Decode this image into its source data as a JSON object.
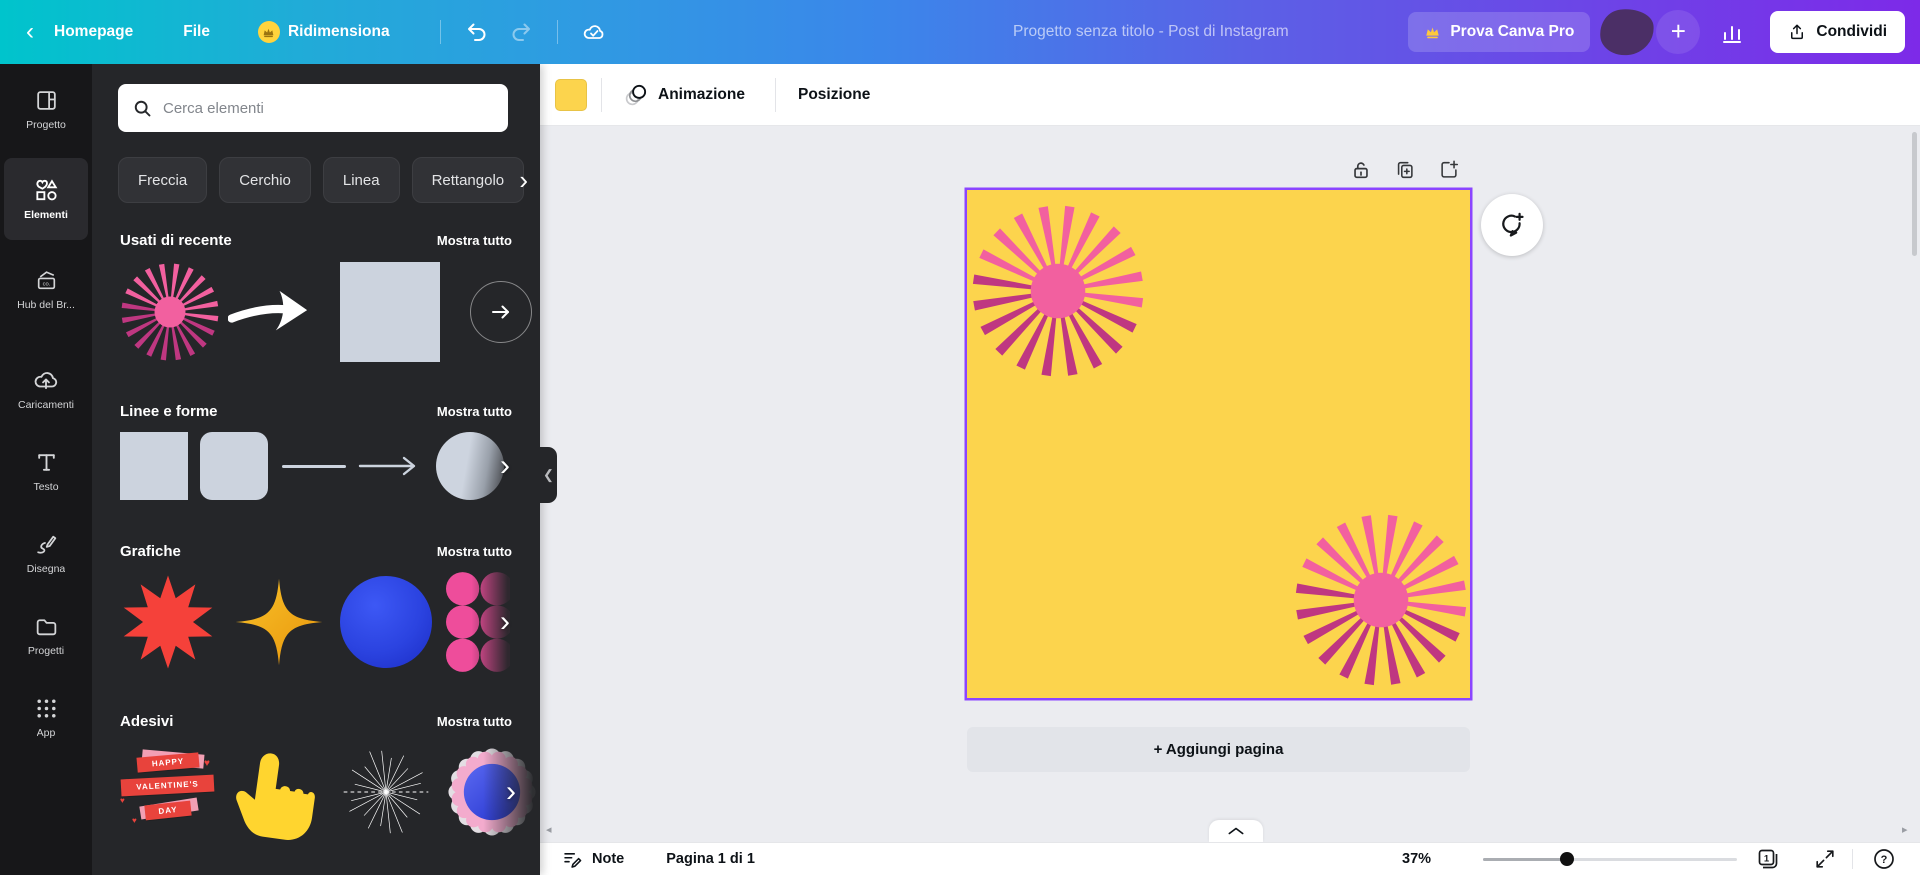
{
  "topbar": {
    "back": "‹",
    "homepage": "Homepage",
    "file": "File",
    "resize": "Ridimensiona",
    "title": "Progetto senza titolo - Post di Instagram",
    "try_pro": "Prova Canva Pro",
    "share": "Condividi",
    "plus": "+"
  },
  "rail": {
    "items": [
      {
        "label": "Progetto"
      },
      {
        "label": "Elementi",
        "active": true
      },
      {
        "label": "Hub del Br..."
      },
      {
        "label": "Caricamenti"
      },
      {
        "label": "Testo"
      },
      {
        "label": "Disegna"
      },
      {
        "label": "Progetti"
      },
      {
        "label": "App"
      }
    ]
  },
  "panel": {
    "search_placeholder": "Cerca elementi",
    "chips": [
      "Freccia",
      "Cerchio",
      "Linea",
      "Rettangolo"
    ],
    "chevron": "›",
    "sections": [
      {
        "title": "Usati di recente",
        "link": "Mostra tutto"
      },
      {
        "title": "Linee e forme",
        "link": "Mostra tutto"
      },
      {
        "title": "Grafiche",
        "link": "Mostra tutto"
      },
      {
        "title": "Adesivi",
        "link": "Mostra tutto"
      }
    ],
    "sticker_valentine": {
      "line1": "HAPPY",
      "line2": "VALENTINE'S",
      "line3": "DAY",
      "heart": "♥"
    }
  },
  "toolbar": {
    "animation": "Animazione",
    "position": "Posizione"
  },
  "canvas": {
    "add_page": "+ Aggiungi pagina"
  },
  "bottombar": {
    "notes": "Note",
    "page_indicator": "Pagina 1 di 1",
    "zoom": "37%",
    "page_count": "1"
  },
  "colors": {
    "gradient_left": "#00c4cc",
    "gradient_right": "#7d2ae8",
    "page_yellow": "#fcd44d",
    "selection_purple": "#8b45ff",
    "starburst_bright": "#f2609f",
    "starburst_dark": "#bf3781",
    "graphic_red": "#f5413a",
    "graphic_gold": "#f8b41d",
    "graphic_blue": "#2b43e0",
    "graphic_pink": "#ee4d9b",
    "sticker_hand": "#ffd52f",
    "crown_gold": "#ffd43d"
  }
}
